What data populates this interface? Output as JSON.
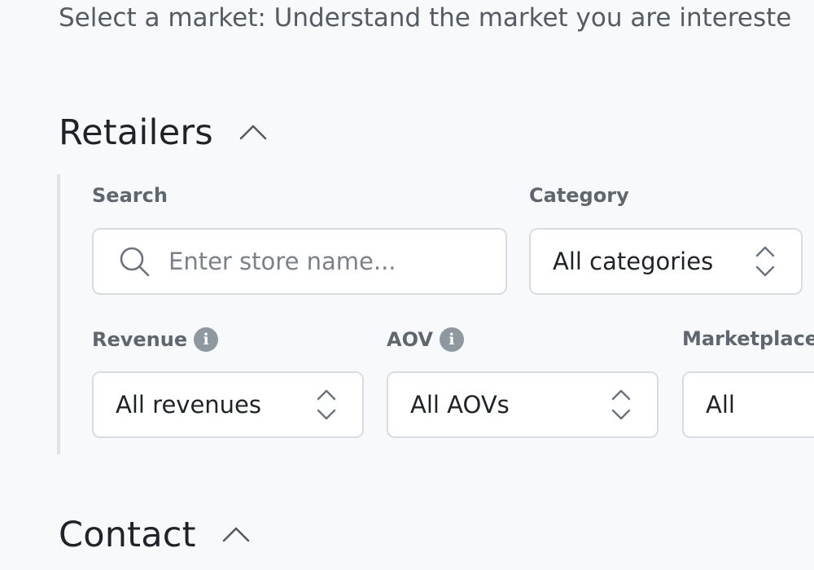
{
  "intro": {
    "text": "Select a market: Understand the market you are intereste"
  },
  "sections": {
    "retailers": {
      "title": "Retailers",
      "filters": {
        "search": {
          "label": "Search",
          "placeholder": "Enter store name...",
          "value": ""
        },
        "category": {
          "label": "Category",
          "value": "All categories"
        },
        "revenue": {
          "label": "Revenue",
          "value": "All revenues"
        },
        "aov": {
          "label": "AOV",
          "value": "All AOVs"
        },
        "marketplace": {
          "label": "Marketplace",
          "value": "All"
        }
      }
    },
    "contact": {
      "title": "Contact"
    }
  },
  "icons": {
    "collapse": "chevron-up-icon",
    "search": "search-icon",
    "info": "info-icon",
    "select": "up-down-chevron-icon"
  },
  "colors": {
    "background": "#f8f9fb",
    "border": "#d9dde2",
    "panel_rule": "#dfe3e8",
    "label": "#5f6670",
    "info_icon": "#8f97a1"
  }
}
